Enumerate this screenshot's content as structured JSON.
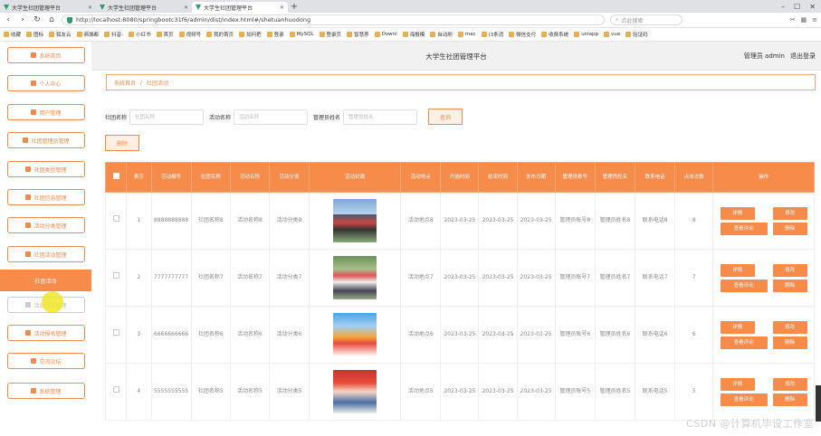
{
  "browser": {
    "tabs": [
      {
        "label": "大学生社团管理平台",
        "active": false
      },
      {
        "label": "大学生社团管理平台",
        "active": false
      },
      {
        "label": "大学生社团管理平台",
        "active": true
      }
    ],
    "url": "http://localhost:8080/springbootc31f6/admin/dist/index.html#/shetuanhuodong",
    "search_placeholder": "点此搜索",
    "bookmarks": [
      "收藏",
      "图标",
      "狐友云",
      "商城都",
      "抖音-",
      "小红书",
      "首页",
      "视频号",
      "我的首页",
      "如何把",
      "登录",
      "MySQL",
      "登录页",
      "智慧养",
      "Downl",
      "海报模",
      "自动刷",
      "mac",
      "(3条消",
      "微信支付",
      "收费系统",
      "unlapp",
      "vue",
      "验证码"
    ]
  },
  "header": {
    "title": "大学生社团管理平台",
    "user": "管理员 admin",
    "logout": "退出登录"
  },
  "sidebar": {
    "items": [
      {
        "label": "系统首页",
        "icon": "home-icon"
      },
      {
        "label": "个人中心",
        "icon": "user-icon"
      },
      {
        "label": "用户管理",
        "icon": "list-icon"
      },
      {
        "label": "社团管理员管理",
        "icon": "grid-icon"
      },
      {
        "label": "社团类型管理",
        "icon": "list-icon"
      },
      {
        "label": "社团信息管理",
        "icon": "chart-icon"
      },
      {
        "label": "活动分类管理",
        "icon": "grid-icon"
      },
      {
        "label": "社团活动管理",
        "icon": "grid-icon"
      },
      {
        "label": "社团活动",
        "icon": "",
        "active": true
      },
      {
        "label": "活动报名管理",
        "icon": "list-icon"
      },
      {
        "label": "活动报名管理",
        "icon": "check-icon"
      },
      {
        "label": "交流论坛",
        "icon": "forum-icon"
      },
      {
        "label": "系统管理",
        "icon": "grid-icon"
      }
    ]
  },
  "breadcrumb": {
    "home": "系统首页",
    "sep": "/",
    "current": "社团活动"
  },
  "filters": {
    "club_label": "社团名称",
    "club_placeholder": "社团名称",
    "activity_label": "活动名称",
    "activity_placeholder": "活动名称",
    "admin_label": "管理员姓名",
    "admin_placeholder": "管理员姓名",
    "search_button": "查询",
    "delete_button": "删除"
  },
  "table": {
    "headers": [
      "索引",
      "活动编号",
      "社团名称",
      "活动名称",
      "活动分类",
      "活动封面",
      "活动地点",
      "开始时间",
      "结束时间",
      "发布日期",
      "管理员账号",
      "管理员姓名",
      "联系电话",
      "点击次数",
      "操作"
    ],
    "rows": [
      {
        "index": "1",
        "no": "8888888888",
        "club": "社团名称8",
        "name": "活动名称8",
        "cat": "活动分类8",
        "place": "活动地点8",
        "start": "2023-03-25",
        "end": "2023-03-25",
        "pub": "2023-03-25",
        "acct": "管理员账号8",
        "admin": "管理员姓名8",
        "phone": "联系电话8",
        "clicks": "8"
      },
      {
        "index": "2",
        "no": "7777777777",
        "club": "社团名称7",
        "name": "活动名称7",
        "cat": "活动分类7",
        "place": "活动地点7",
        "start": "2023-03-25",
        "end": "2023-03-25",
        "pub": "2023-03-25",
        "acct": "管理员账号7",
        "admin": "管理员姓名7",
        "phone": "联系电话7",
        "clicks": "7"
      },
      {
        "index": "3",
        "no": "6666666666",
        "club": "社团名称6",
        "name": "活动名称6",
        "cat": "活动分类6",
        "place": "活动地点6",
        "start": "2023-03-25",
        "end": "2023-03-25",
        "pub": "2023-03-25",
        "acct": "管理员账号6",
        "admin": "管理员姓名6",
        "phone": "联系电话6",
        "clicks": "6"
      },
      {
        "index": "4",
        "no": "5555555555",
        "club": "社团名称5",
        "name": "活动名称5",
        "cat": "活动分类5",
        "place": "活动地点5",
        "start": "2023-03-25",
        "end": "2023-03-25",
        "pub": "2023-03-25",
        "acct": "管理员账号5",
        "admin": "管理员姓名5",
        "phone": "联系电话5",
        "clicks": "5"
      }
    ],
    "actions": {
      "detail": "详情",
      "edit": "修改",
      "review": "查看评论",
      "delete": "删除"
    }
  },
  "watermark": "CSDN @计算机毕设工作室",
  "colors": {
    "accent": "#f78b4a",
    "border": "#f08a4b"
  }
}
